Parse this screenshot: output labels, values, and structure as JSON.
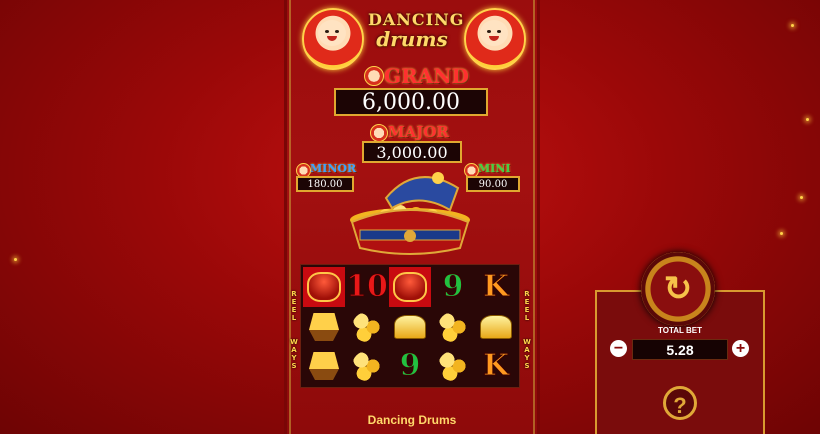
{
  "game": {
    "logo_line1": "DANCING",
    "logo_line2": "drums",
    "title": "Dancing Drums"
  },
  "jackpots": {
    "grand": {
      "label": "GRAND",
      "value": "6,000.00"
    },
    "major": {
      "label": "MAJOR",
      "value": "3,000.00"
    },
    "minor": {
      "label": "MINOR",
      "value": "180.00"
    },
    "mini": {
      "label": "MINI",
      "value": "90.00"
    }
  },
  "reels": {
    "side_label": "REEL WAYS",
    "symbols": [
      [
        "drum",
        "ship",
        "ship"
      ],
      [
        "10",
        "coins",
        "coins"
      ],
      [
        "drum",
        "ingot",
        "9"
      ],
      [
        "9",
        "coins",
        "coins"
      ],
      [
        "K",
        "ingot",
        "K"
      ]
    ]
  },
  "controls": {
    "total_bet_label": "TOTAL BET",
    "total_bet_value": "5.28",
    "minus_label": "−",
    "plus_label": "+",
    "help_label": "?",
    "spin_icon": "spin-arrow-icon"
  },
  "colors": {
    "background": "#9a0808",
    "accent_gold": "#e0a838",
    "jackpot_red": "#ff3030"
  }
}
